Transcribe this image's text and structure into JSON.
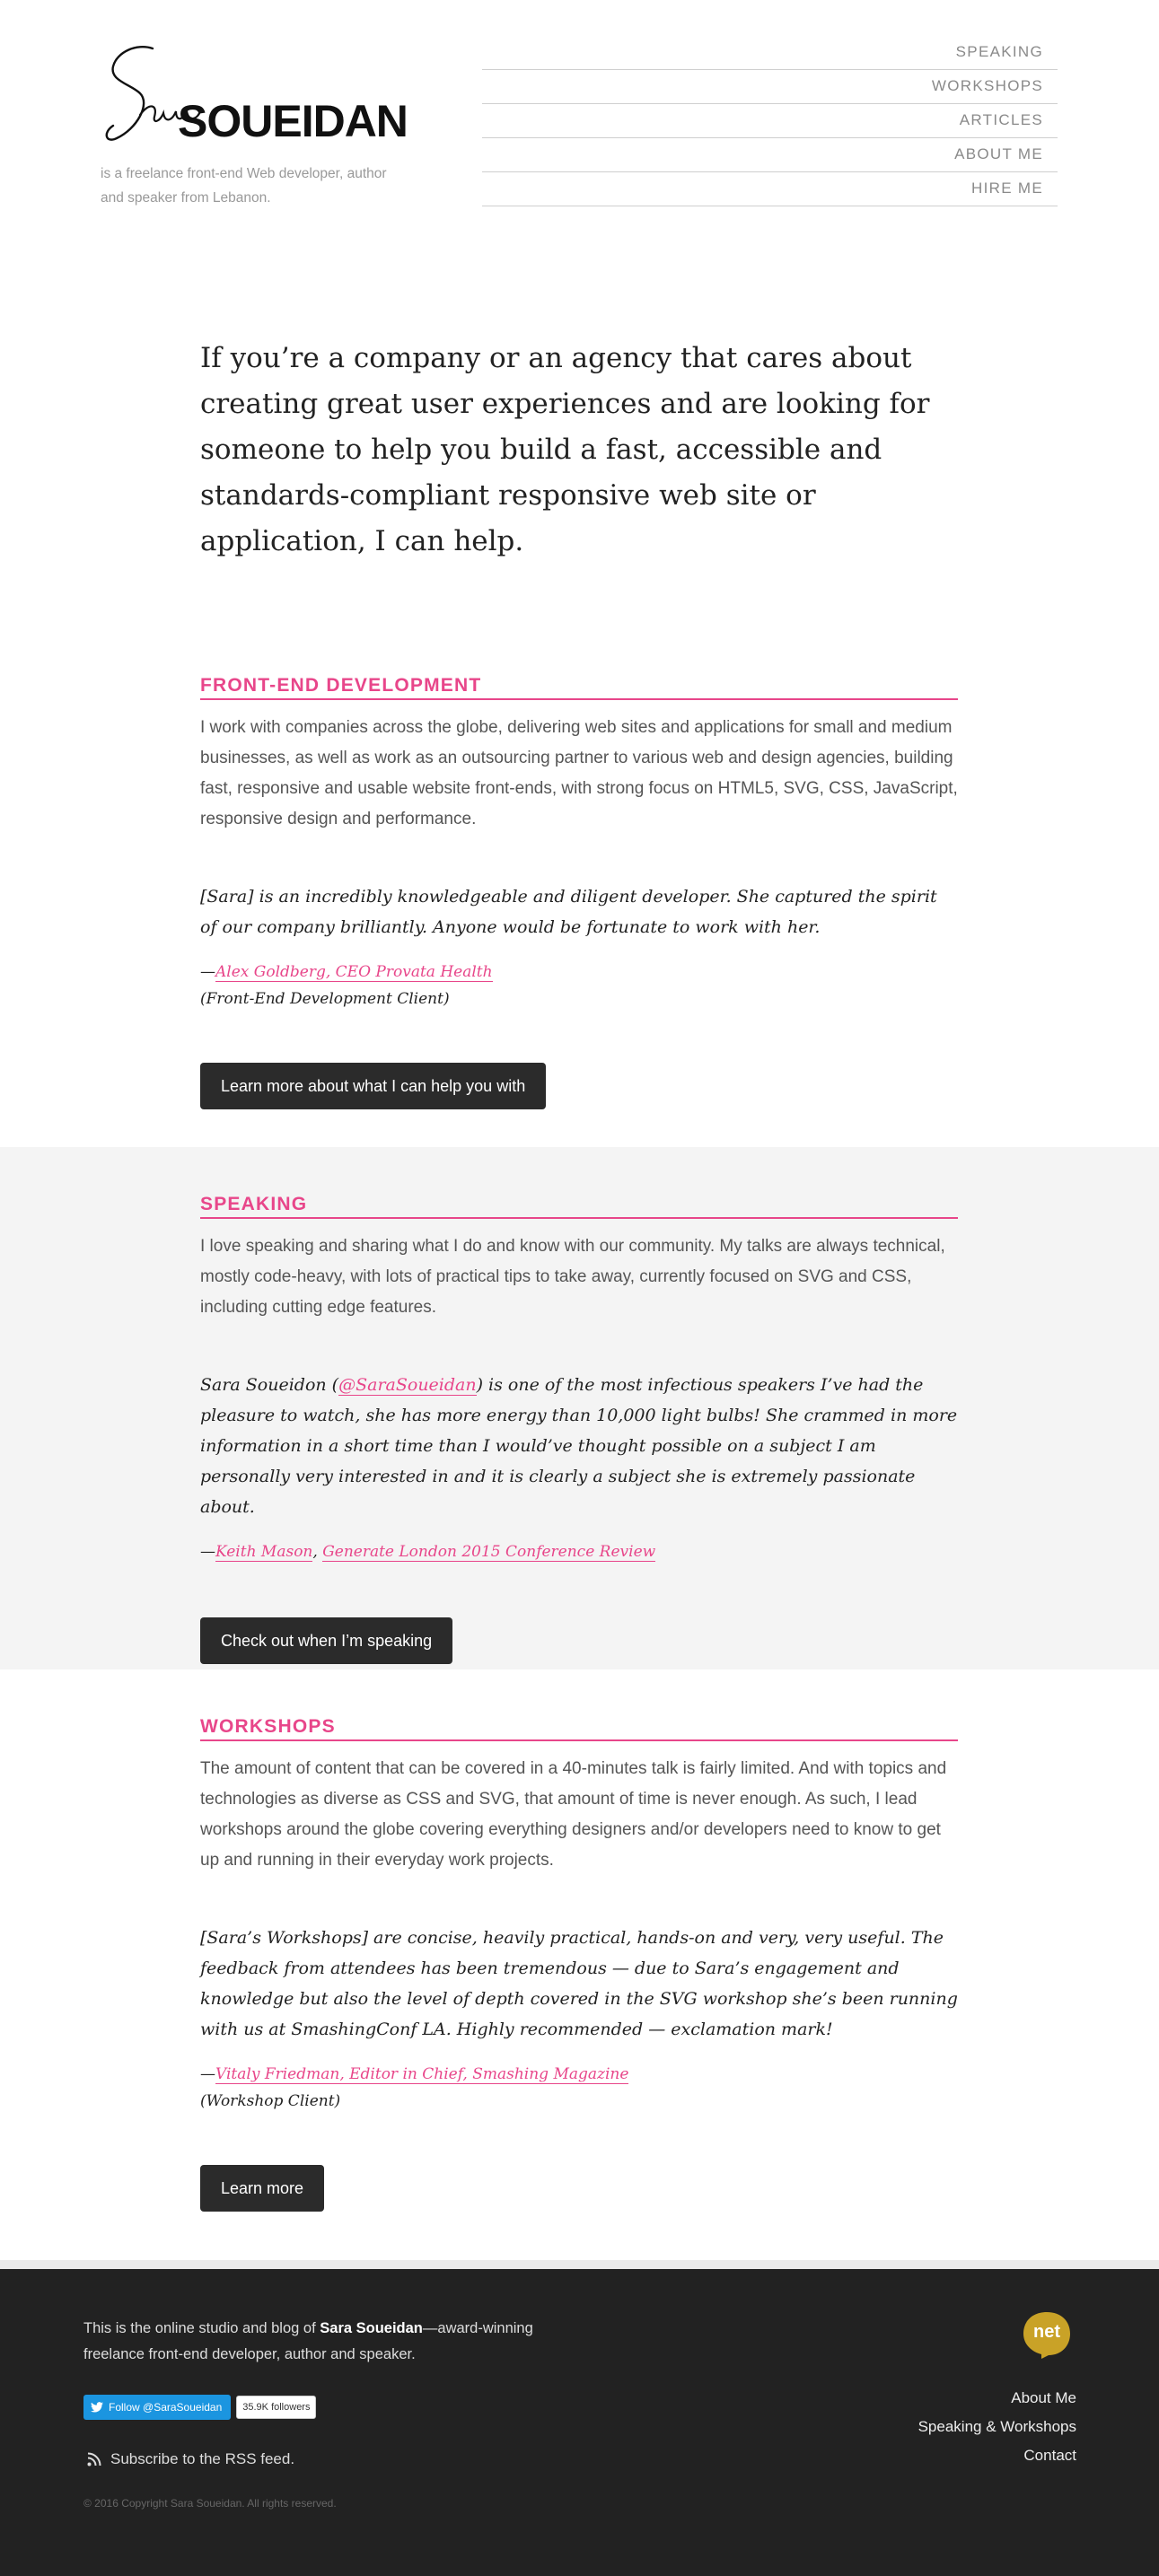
{
  "header": {
    "logo_script": "Sara",
    "logo_word": "SOUEIDAN",
    "tagline": "is a freelance front-end Web developer, author and speaker from Lebanon.",
    "nav": [
      "SPEAKING",
      "WORKSHOPS",
      "ARTICLES",
      "ABOUT ME",
      "HIRE ME"
    ]
  },
  "intro": "If you’re a company or an agency that cares about creating great user experiences and are looking for someone to help you build a fast, accessible and standards-compliant responsive web site or application, I can help.",
  "sections": {
    "frontend": {
      "title": "FRONT-END DEVELOPMENT",
      "body": "I work with companies across the globe, delivering web sites and applications for small and medium businesses, as well as work as an outsourcing partner to various web and design agencies, building fast, responsive and usable website front-ends, with strong focus on HTML5, SVG, CSS, JavaScript, responsive design and performance.",
      "quote": "[Sara] is an incredibly knowledgeable and diligent developer. She captured the spirit of our company brilliantly. Anyone would be fortunate to work with her.",
      "cite_dash": "—",
      "cite_link": "Alex Goldberg, CEO Provata Health",
      "cite_note": "(Front-End Development Client)",
      "button": "Learn more about what I can help you with"
    },
    "speaking": {
      "title": "SPEAKING",
      "body": "I love speaking and sharing what I do and know with our community. My talks are always technical, mostly code-heavy, with lots of practical tips to take away, currently focused on SVG and CSS, including cutting edge features.",
      "quote_pre": "Sara Soueidon (",
      "quote_handle": "@SaraSoueidan",
      "quote_post": ") is one of the most infectious speakers I’ve had the pleasure to watch, she has more energy than 10,000 light bulbs! She crammed in more information in a short time than I would’ve thought possible on a subject I am personally very interested in and it is clearly a subject she is extremely passionate about.",
      "cite_dash": "—",
      "cite_link1": "Keith Mason",
      "cite_sep": ", ",
      "cite_link2": "Generate London 2015 Conference Review",
      "button": "Check out when I’m speaking"
    },
    "workshops": {
      "title": "WORKSHOPS",
      "body": "The amount of content that can be covered in a 40-minutes talk is fairly limited. And with topics and technologies as diverse as CSS and SVG, that amount of time is never enough. As such, I lead workshops around the globe covering everything designers and/or developers need to know to get up and running in their everyday work projects.",
      "quote": "[Sara’s Workshops] are concise, heavily practical, hands-on and very, very useful. The feedback from attendees has been tremendous — due to Sara’s engagement and knowledge but also the level of depth covered in the SVG workshop she’s been running with us at SmashingConf LA. Highly recommended — exclamation mark!",
      "cite_dash": "—",
      "cite_link": "Vitaly Friedman, Editor in Chief, Smashing Magazine",
      "cite_note": "(Workshop Client)",
      "button": "Learn more"
    }
  },
  "footer": {
    "about_pre": "This is the online studio and blog of ",
    "about_name": "Sara Soueidan",
    "about_post": "—award-winning freelance front-end developer, author and speaker.",
    "follow_label": "Follow @SaraSoueidan",
    "follow_count": "35.9K followers",
    "rss": "Subscribe to the RSS feed.",
    "copyright": "© 2016 Copyright Sara Soueidan. All rights reserved.",
    "badge": "net",
    "links": [
      "About Me",
      "Speaking & Workshops",
      "Contact"
    ]
  },
  "colors": {
    "accent": "#e8468a",
    "button": "#2b2b2b",
    "footer": "#222222",
    "twitter": "#1b95e0",
    "badge": "#c9a227"
  },
  "icons": [
    "twitter-bird-icon",
    "rss-icon",
    "net-award-badge"
  ]
}
